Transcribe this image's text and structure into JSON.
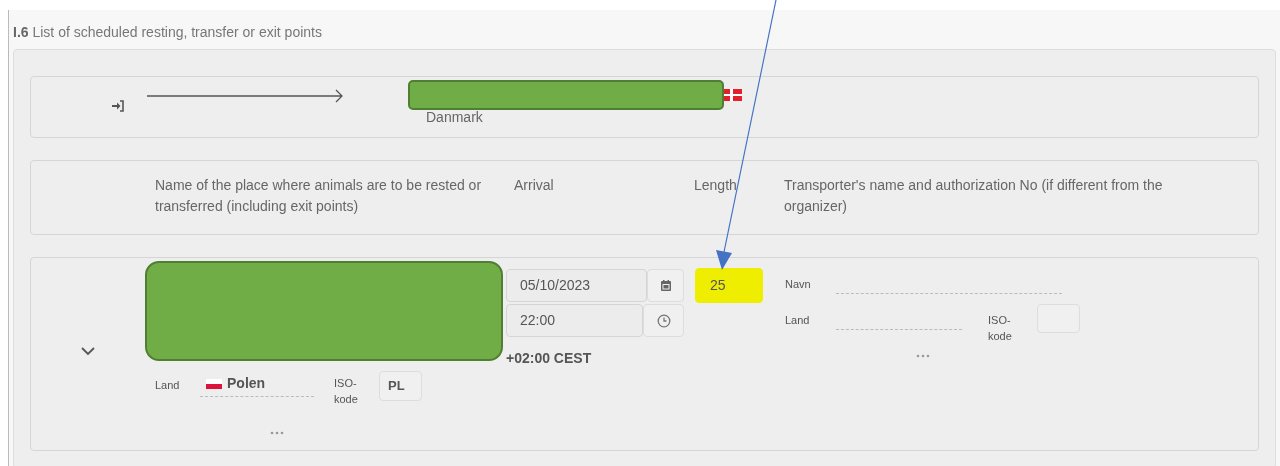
{
  "section": {
    "number": "I.6",
    "title": "List of scheduled resting, transfer or exit points"
  },
  "route": {
    "destination_country": "Danmark"
  },
  "headers": [
    "Name of the place where animals are to be rested or transferred (including exit points)",
    "Arrival",
    "Length",
    "Transporter's name and authorization No (if different from the organizer)"
  ],
  "stop": {
    "expanded": true,
    "place": {
      "country_label": "Land",
      "country": "Polen",
      "iso_label": "ISO-kode",
      "iso": "PL"
    },
    "arrival": {
      "date": "05/10/2023",
      "time": "22:00",
      "timezone": "+02:00 CEST"
    },
    "length": {
      "value": "25",
      "highlighted": true
    },
    "transporter": {
      "name_label": "Navn",
      "country_label": "Land",
      "iso_label": "ISO-kode"
    }
  }
}
